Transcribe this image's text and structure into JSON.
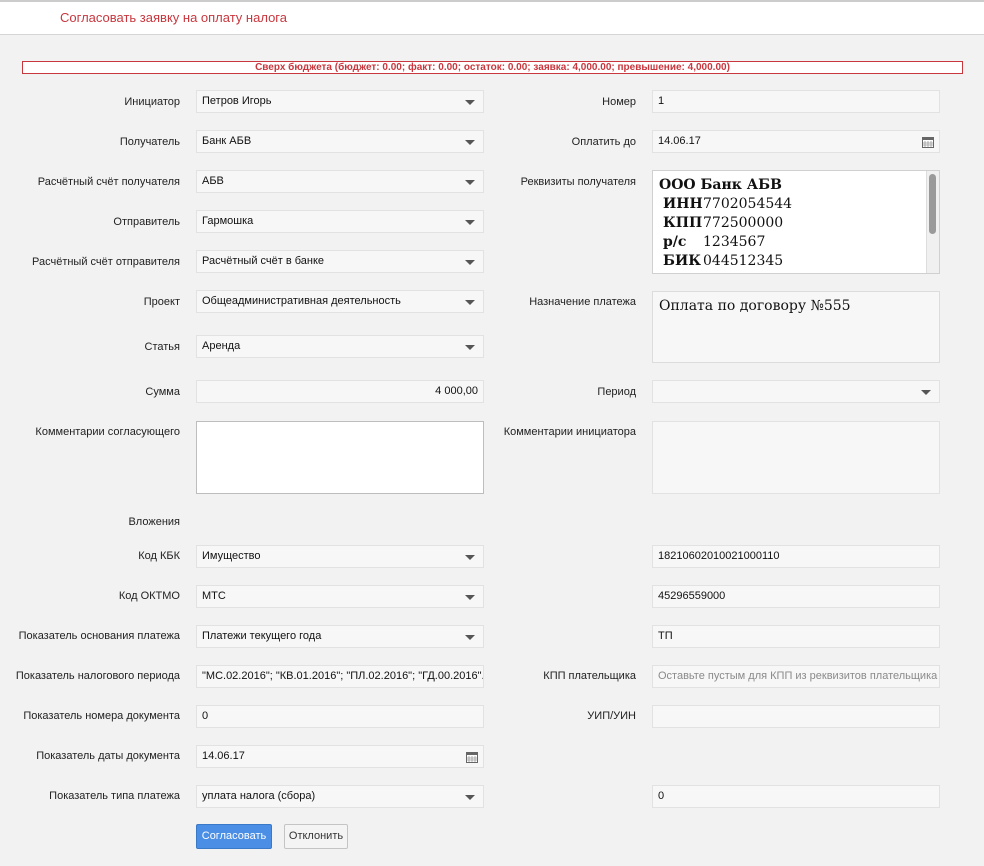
{
  "header": {
    "title": "Согласовать заявку на оплату налога"
  },
  "warning": "Сверх бюджета (бюджет: 0.00; факт: 0.00; остаток: 0.00; заявка: 4,000.00; превышение: 4,000.00)",
  "left": {
    "initiator": {
      "label": "Инициатор",
      "value": "Петров Игорь"
    },
    "recipient": {
      "label": "Получатель",
      "value": "Банк АБВ"
    },
    "recipient_account": {
      "label": "Расчётный счёт получателя",
      "value": "АБВ"
    },
    "sender": {
      "label": "Отправитель",
      "value": "Гармошка"
    },
    "sender_account": {
      "label": "Расчётный счёт отправителя",
      "value": "Расчётный счёт в банке"
    },
    "project": {
      "label": "Проект",
      "value": "Общеадминистративная деятельность"
    },
    "article": {
      "label": "Статья",
      "value": "Аренда"
    },
    "amount": {
      "label": "Сумма",
      "value": "4 000,00"
    },
    "approver_comments": {
      "label": "Комментарии согласующего",
      "value": ""
    },
    "attachments": {
      "label": "Вложения"
    },
    "kbk": {
      "label": "Код КБК",
      "value": "Имущество"
    },
    "oktmo": {
      "label": "Код ОКТМО",
      "value": "МТС"
    },
    "basis": {
      "label": "Показатель основания платежа",
      "value": "Платежи текущего года"
    },
    "tax_period": {
      "label": "Показатель налогового периода",
      "value": "\"МС.02.2016\"; \"КВ.01.2016\"; \"ПЛ.02.2016\"; \"ГД.00.2016\"."
    },
    "doc_number": {
      "label": "Показатель номера документа",
      "value": "0"
    },
    "doc_date": {
      "label": "Показатель даты документа",
      "value": "14.06.17"
    },
    "payment_type": {
      "label": "Показатель типа платежа",
      "value": "уплата налога (сбора)"
    }
  },
  "right": {
    "number": {
      "label": "Номер",
      "value": "1"
    },
    "pay_until": {
      "label": "Оплатить до",
      "value": "14.06.17"
    },
    "recipient_details": {
      "label": "Реквизиты получателя",
      "company": "ООО Банк АБВ",
      "rows": [
        {
          "k": "ИНН",
          "v": "7702054544"
        },
        {
          "k": "КПП",
          "v": "772500000"
        },
        {
          "k": "р/с",
          "v": "1234567"
        },
        {
          "k": "БИК",
          "v": "044512345"
        }
      ]
    },
    "payment_purpose": {
      "label": "Назначение платежа",
      "value": "Оплата по договору №555"
    },
    "period": {
      "label": "Период",
      "value": ""
    },
    "initiator_comments": {
      "label": "Комментарии инициатора",
      "value": ""
    },
    "kbk_code": {
      "value": "18210602010021000110"
    },
    "oktmo_code": {
      "value": "45296559000"
    },
    "basis_code": {
      "value": "ТП"
    },
    "payer_kpp": {
      "label": "КПП плательщика",
      "placeholder": "Оставьте пустым для КПП из реквизитов плательщика"
    },
    "uip": {
      "label": "УИП/УИН",
      "value": ""
    },
    "payment_type_code": {
      "value": "0"
    }
  },
  "buttons": {
    "approve": "Согласовать",
    "reject": "Отклонить"
  },
  "colors": {
    "accent": "#c8373e",
    "primary": "#4a8ee6"
  },
  "icons": {
    "dropdown": "chevron-down-icon",
    "calendar": "calendar-icon"
  }
}
